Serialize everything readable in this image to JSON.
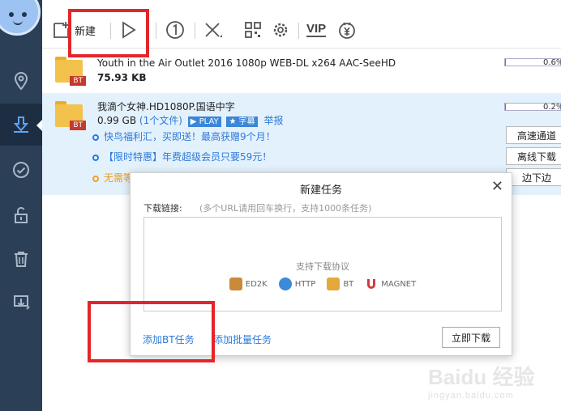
{
  "toolbar": {
    "new_label": "新建",
    "vip_label": "VIP"
  },
  "tasks": [
    {
      "name": "Youth in the Air Outlet 2016 1080p WEB-DL x264 AAC-SeeHD",
      "size": "75.93 KB",
      "type_badge": "BT",
      "progress_text": "0.6%",
      "progress": 0.6
    },
    {
      "name": "我滴个女神.HD1080P.国语中字",
      "size": "0.99 GB",
      "file_count": "(1个文件)",
      "play_tag": "PLAY",
      "subtitle_tag": "字幕",
      "report": "举报",
      "type_badge": "BT",
      "progress_text": "0.2%",
      "progress": 0.2,
      "promos": [
        "快鸟福利汇，买即送！最高获赠9个月！",
        "【限时特惠】年费超级会员只要59元！",
        "无需等待"
      ],
      "actions": [
        "高速通道",
        "离线下载",
        "边下边"
      ]
    }
  ],
  "dialog": {
    "title": "新建任务",
    "close": "✕",
    "link_label": "下载链接:",
    "link_hint": "(多个URL请用回车换行，支持1000条任务)",
    "protocol_title": "支持下载协议",
    "protocols": [
      "ED2K",
      "HTTP",
      "BT",
      "MAGNET"
    ],
    "add_bt": "添加BT任务",
    "add_batch": "添加批量任务",
    "download_now": "立即下载"
  },
  "watermark": {
    "main": "Baidu 经验",
    "sub": "jingyan.baidu.com"
  },
  "colors": {
    "sidebar": "#2b3f56",
    "accent": "#2d7ad8",
    "highlight_row": "#e3f1fd",
    "annotation_red": "#e3262b"
  }
}
